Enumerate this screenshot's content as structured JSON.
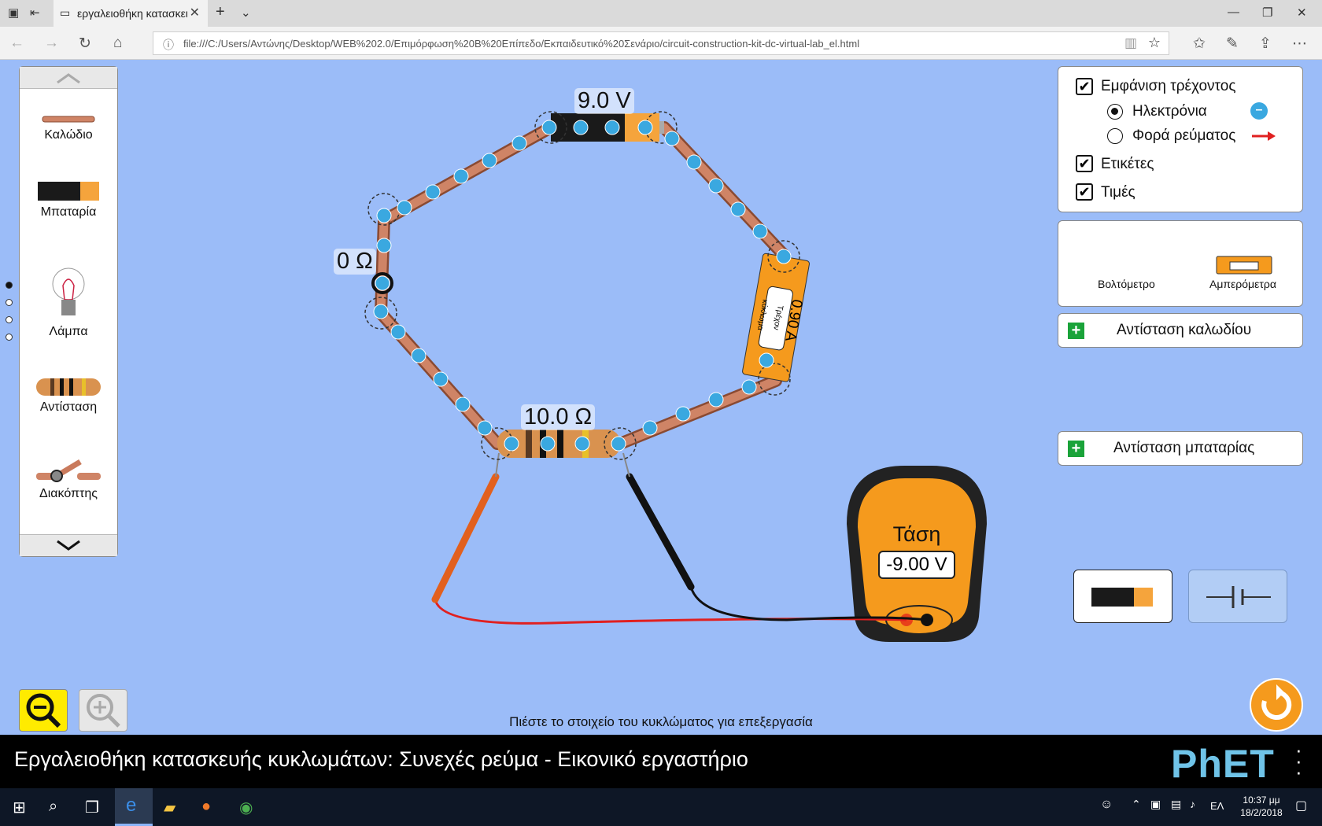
{
  "browser": {
    "tab_title": "εργαλειοθήκη κατασκει",
    "url": "file:///C:/Users/Αντώνης/Desktop/WEB%202.0/Επιμόρφωση%20Β%20Επίπεδο/Εκπαιδευτικό%20Σενάριο/circuit-construction-kit-dc-virtual-lab_el.html"
  },
  "toolbox": {
    "items": [
      {
        "label": "Καλώδιο",
        "icon": "wire-icon"
      },
      {
        "label": "Μπαταρία",
        "icon": "battery-icon"
      },
      {
        "label": "Λάμπα",
        "icon": "bulb-icon"
      },
      {
        "label": "Αντίσταση",
        "icon": "resistor-icon"
      },
      {
        "label": "Διακόπτης",
        "icon": "switch-icon"
      }
    ]
  },
  "circuit": {
    "battery_label": "9.0 V",
    "wire_resistance_label": "0 Ω",
    "resistor_label": "10.0 Ω",
    "ammeter_reading": "0.90 A",
    "ammeter_caption": "Τρέχον κύκλωμα"
  },
  "voltmeter": {
    "title": "Τάση",
    "value": "-9.00 V"
  },
  "display_panel": {
    "show_current": "Εμφάνιση τρέχοντος",
    "show_current_checked": true,
    "electrons": "Ηλεκτρόνια",
    "electrons_selected": true,
    "conventional": "Φορά ρεύματος",
    "labels": "Ετικέτες",
    "labels_checked": true,
    "values": "Τιμές",
    "values_checked": true
  },
  "sensor_panel": {
    "voltmeter_label": "Βολτόμετρο",
    "ammeter_label": "Αμπερόμετρα"
  },
  "accordions": {
    "wire_resistance": "Αντίσταση καλωδίου",
    "battery_resistance": "Αντίσταση μπαταρίας"
  },
  "hint": "Πιέστε το στοιχείο του κυκλώματος για επεξεργασία",
  "footer": {
    "sim_title": "Εργαλειοθήκη κατασκευής κυκλωμάτων: Συνεχές ρεύμα - Εικονικό εργαστήριο",
    "logo": "PhET"
  },
  "taskbar": {
    "language": "ΕΛ",
    "time": "10:37 μμ",
    "date": "18/2/2018"
  },
  "colors": {
    "background": "#9bbcf8",
    "wire": "#c97a5c",
    "electron": "#3aa8e0",
    "accent_orange": "#f59a1d",
    "plus_green": "#1aa33a"
  }
}
